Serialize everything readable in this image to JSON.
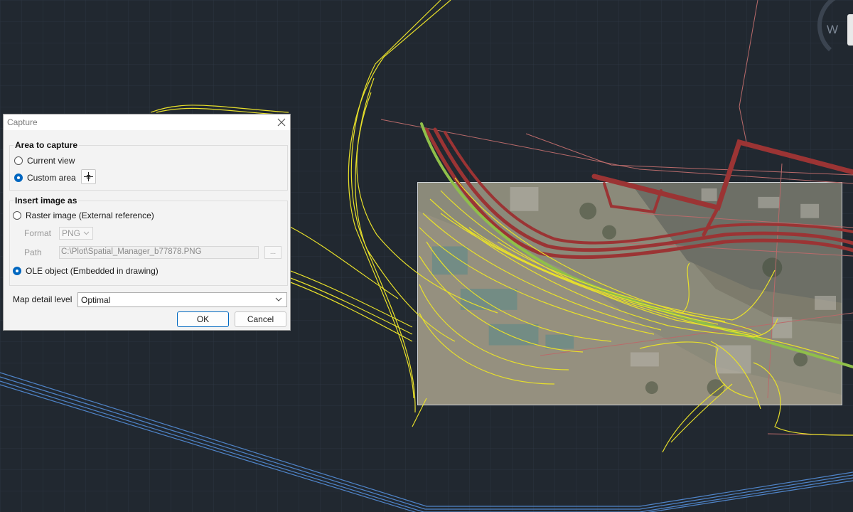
{
  "canvas": {
    "background": "#212830",
    "compass_label": "W"
  },
  "dialog": {
    "title": "Capture",
    "area_group": {
      "label": "Area to capture",
      "option_current_view": "Current view",
      "option_custom_area": "Custom area",
      "selected": "Custom area"
    },
    "insert_group": {
      "label": "Insert image as",
      "option_raster": "Raster image (External reference)",
      "format_label": "Format",
      "format_value": "PNG",
      "path_label": "Path",
      "path_value": "C:\\Plot\\Spatial_Manager_b77878.PNG",
      "browse_label": "...",
      "option_ole": "OLE object (Embedded in drawing)",
      "selected": "OLE object (Embedded in drawing)"
    },
    "detail": {
      "label": "Map detail level",
      "value": "Optimal"
    },
    "ok_label": "OK",
    "cancel_label": "Cancel"
  },
  "colors": {
    "rail_yellow": "#e8e02a",
    "road_red": "#9b3434",
    "line_green": "#8fbf4a",
    "boundary_blue": "#4f84c8",
    "accent": "#0067c0"
  }
}
